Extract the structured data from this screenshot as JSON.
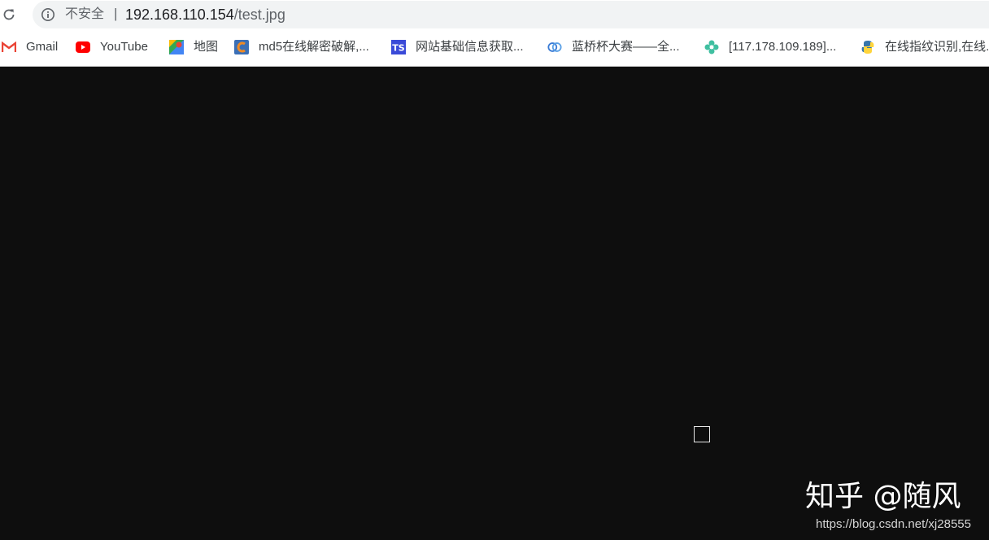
{
  "address_bar": {
    "security_label": "不安全",
    "separator": "|",
    "url_host": "192.168.110.154",
    "url_path": "/test.jpg"
  },
  "bookmarks": [
    {
      "label": "Gmail",
      "icon": "gmail-icon"
    },
    {
      "label": "YouTube",
      "icon": "youtube-icon"
    },
    {
      "label": "地图",
      "icon": "maps-icon"
    },
    {
      "label": "md5在线解密破解,...",
      "icon": "cmd5-icon"
    },
    {
      "label": "网站基础信息获取...",
      "icon": "ts-icon"
    },
    {
      "label": "蓝桥杯大赛——全...",
      "icon": "lanqiao-icon"
    },
    {
      "label": "[117.178.109.189]...",
      "icon": "flower-icon"
    },
    {
      "label": "在线指纹识别,在线...",
      "icon": "python-icon"
    }
  ],
  "watermark": {
    "title": "知乎 @随风",
    "url": "https://blog.csdn.net/xj28555"
  },
  "colors": {
    "page_background": "#0e0e0e",
    "omnibox_background": "#f1f3f4",
    "youtube_red": "#ff0000",
    "gmail_red": "#ea4335"
  }
}
